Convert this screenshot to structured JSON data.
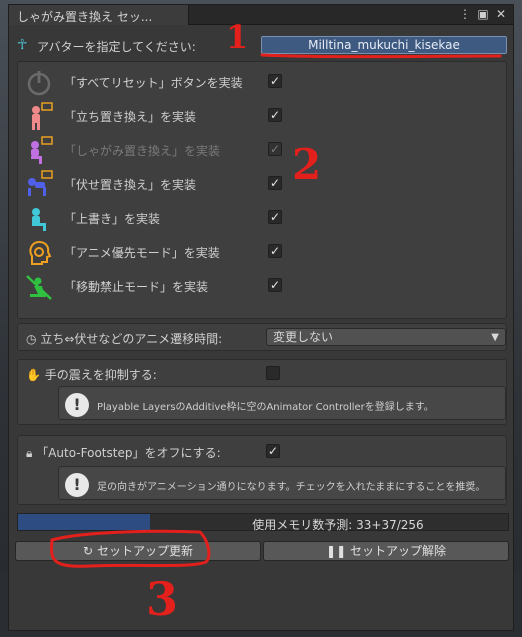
{
  "window": {
    "tab_title": "しゃがみ置き換え セッ...",
    "icons": [
      "more-icon",
      "maximize-icon",
      "close-icon"
    ]
  },
  "avatar": {
    "label": "アバターを指定してください:",
    "value": "Milltina_mukuchi_kisekae"
  },
  "features": [
    {
      "label": "「すべてリセット」ボタンを実装",
      "checked": true,
      "icon": "power-icon",
      "enabled": true
    },
    {
      "label": "「立ち置き換え」を実装",
      "checked": true,
      "icon": "standing-figure-icon",
      "enabled": true
    },
    {
      "label": "「しゃがみ置き換え」を実装",
      "checked": true,
      "icon": "crouching-figure-icon",
      "enabled": false
    },
    {
      "label": "「伏せ置き換え」を実装",
      "checked": true,
      "icon": "prone-figure-icon",
      "enabled": true
    },
    {
      "label": "「上書き」を実装",
      "checked": true,
      "icon": "sitting-figure-icon",
      "enabled": true
    },
    {
      "label": "「アニメ優先モード」を実装",
      "checked": true,
      "icon": "head-gear-icon",
      "enabled": true
    },
    {
      "label": "「移動禁止モード」を実装",
      "checked": true,
      "icon": "no-move-icon",
      "enabled": true
    }
  ],
  "transition": {
    "label": "立ち⇔伏せなどのアニメ遷移時間:",
    "value": "変更しない"
  },
  "tremor": {
    "label": "手の震えを抑制する:",
    "checked": false,
    "help": "Playable LayersのAdditive枠に空のAnimator Controllerを登録します。"
  },
  "footstep": {
    "label": "「Auto-Footstep」をオフにする:",
    "checked": true,
    "help": "足の向きがアニメーション通りになります。チェックを入れたままにすることを推奨。"
  },
  "memory": {
    "text": "使用メモリ数予測:  33+37/256",
    "fraction": 0.27
  },
  "buttons": {
    "setup": "セットアップ更新",
    "remove": "セットアップ解除"
  },
  "annotations": [
    "1",
    "2",
    "3"
  ],
  "colors": {
    "accent_blue": "#3e5a80",
    "annotation_red": "#e3201b",
    "progress_fill": "#2c4c82"
  }
}
